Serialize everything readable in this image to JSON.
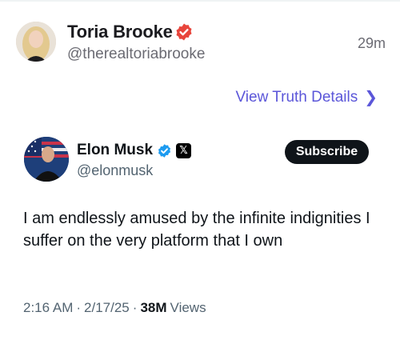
{
  "post": {
    "author_name": "Toria Brooke",
    "author_handle": "@therealtoriabrooke",
    "time_ago": "29m",
    "details_link": "View Truth Details",
    "colors": {
      "verified_badge": "#e8453c",
      "link": "#5b56d9"
    }
  },
  "embedded_tweet": {
    "author_name": "Elon Musk",
    "author_handle": "@elonmusk",
    "subscribe_label": "Subscribe",
    "text": "I am endlessly amused by the infinite indignities I suffer on the very platform that I own",
    "time": "2:16 AM",
    "date": "2/17/25",
    "views_count": "38M",
    "views_label": "Views",
    "separator": "·",
    "x_logo": "𝕏",
    "colors": {
      "verified_badge": "#1d9bf0"
    }
  }
}
